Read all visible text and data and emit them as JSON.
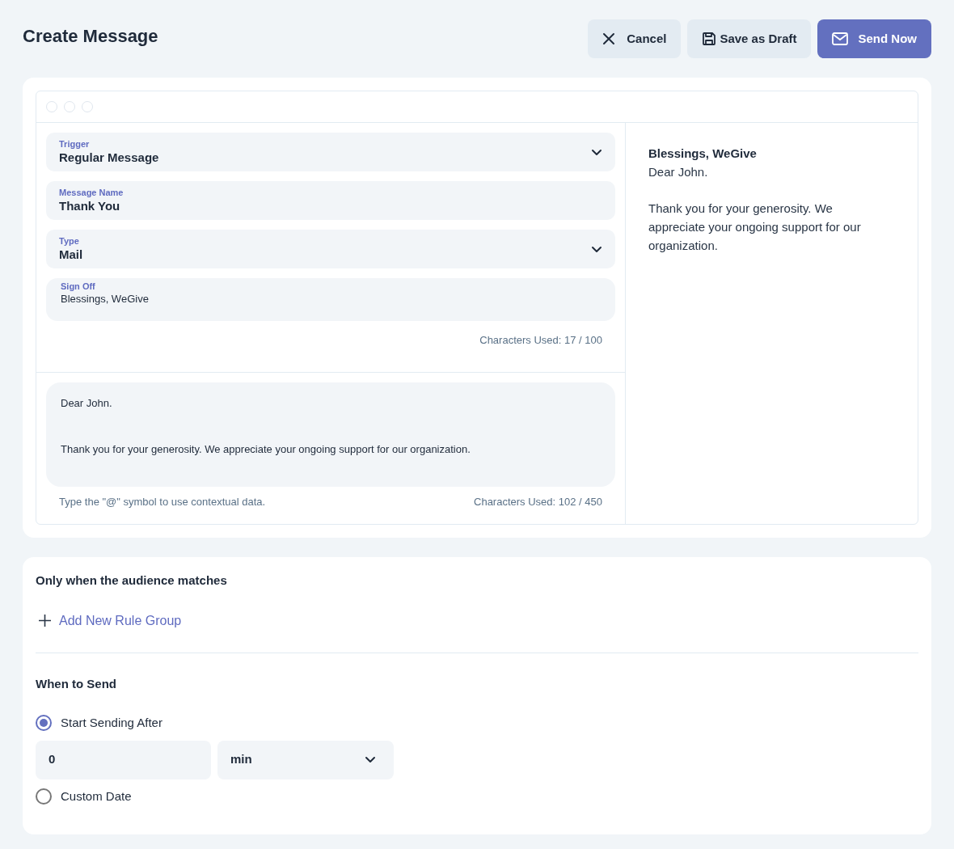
{
  "header": {
    "title": "Create Message",
    "buttons": [
      {
        "label": "Cancel",
        "kind": "cancel"
      },
      {
        "label": "Save as Draft",
        "kind": "draft"
      },
      {
        "label": "Send Now",
        "kind": "send"
      }
    ]
  },
  "editor": {
    "fields": [
      {
        "kind": "select",
        "label": "Trigger",
        "value": "Regular Message"
      },
      {
        "kind": "text",
        "label": "Message Name",
        "value": "Thank You"
      },
      {
        "kind": "select",
        "label": "Type",
        "value": "Mail"
      }
    ],
    "sign_off": {
      "label": "Sign Off",
      "value": "Blessings, WeGive",
      "counter": "Characters Used: 17 / 100"
    },
    "body": {
      "paragraphs": [
        "Dear John.",
        "Thank you for your generosity. We appreciate your ongoing support for our organization."
      ],
      "hint": "Type the \"@\" symbol to use contextual data.",
      "counter": "Characters Used: 102 / 450"
    },
    "preview": {
      "sign_off": "Blessings, WeGive",
      "paragraphs": [
        "Dear John.",
        "Thank you for your generosity. We appreciate your ongoing support for our organization."
      ]
    }
  },
  "audience": {
    "title": "Only when the audience matches",
    "add_rule": "Add New Rule Group"
  },
  "schedule": {
    "title": "When to Send",
    "options": [
      {
        "kind": "delay",
        "label": "Start Sending After",
        "selected": true
      },
      {
        "kind": "date",
        "label": "Custom Date",
        "selected": false
      }
    ],
    "delay": {
      "value": "0",
      "unit": "min"
    }
  }
}
